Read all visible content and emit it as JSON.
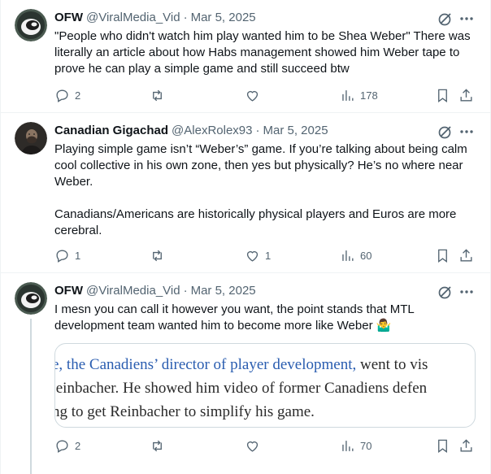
{
  "tweets": [
    {
      "name": "OFW",
      "handle": "@ViralMedia_Vid",
      "sep": "·",
      "date": "Mar 5, 2025",
      "text": "\"People who didn't watch him play wanted him to be Shea Weber\" There was literally an article about how Habs management showed him Weber tape to prove he can play a simple game and still succeed btw",
      "replies": "2",
      "reposts": "",
      "likes": "",
      "views": "178"
    },
    {
      "name": "Canadian Gigachad",
      "handle": "@AlexRolex93",
      "sep": "·",
      "date": "Mar 5, 2025",
      "text": "Playing simple game isn’t “Weber’s” game. If you’re talking about being calm cool collective in his own zone, then yes but physically? He’s no where near Weber.\n\nCanadians/Americans are historically physical players and Euros are more cerebral.",
      "replies": "1",
      "reposts": "",
      "likes": "1",
      "views": "60"
    },
    {
      "name": "OFW",
      "handle": "@ViralMedia_Vid",
      "sep": "·",
      "date": "Mar 5, 2025",
      "text": "I mesn you can call it however you want, the point stands that MTL development team wanted him to become more like Weber 🤷‍♂️",
      "replies": "2",
      "reposts": "",
      "likes": "",
      "views": "70",
      "media": {
        "line1_link": "e, the Canadiens’ director of player development,",
        "line1_rest": " went to vis",
        "line2": ".einbacher. He showed him video of former Canadiens defen",
        "line3": "ng to get Reinbacher to simplify his game."
      }
    }
  ],
  "icons": {
    "reply": "reply-icon",
    "repost": "repost-icon",
    "like": "like-icon",
    "views": "views-icon",
    "bookmark": "bookmark-icon",
    "share": "share-icon",
    "grok": "grok-icon",
    "more": "more-icon"
  },
  "colors": {
    "text": "#0f1419",
    "secondary": "#536471",
    "border": "#eff3f4",
    "link": "#2a5db0"
  }
}
